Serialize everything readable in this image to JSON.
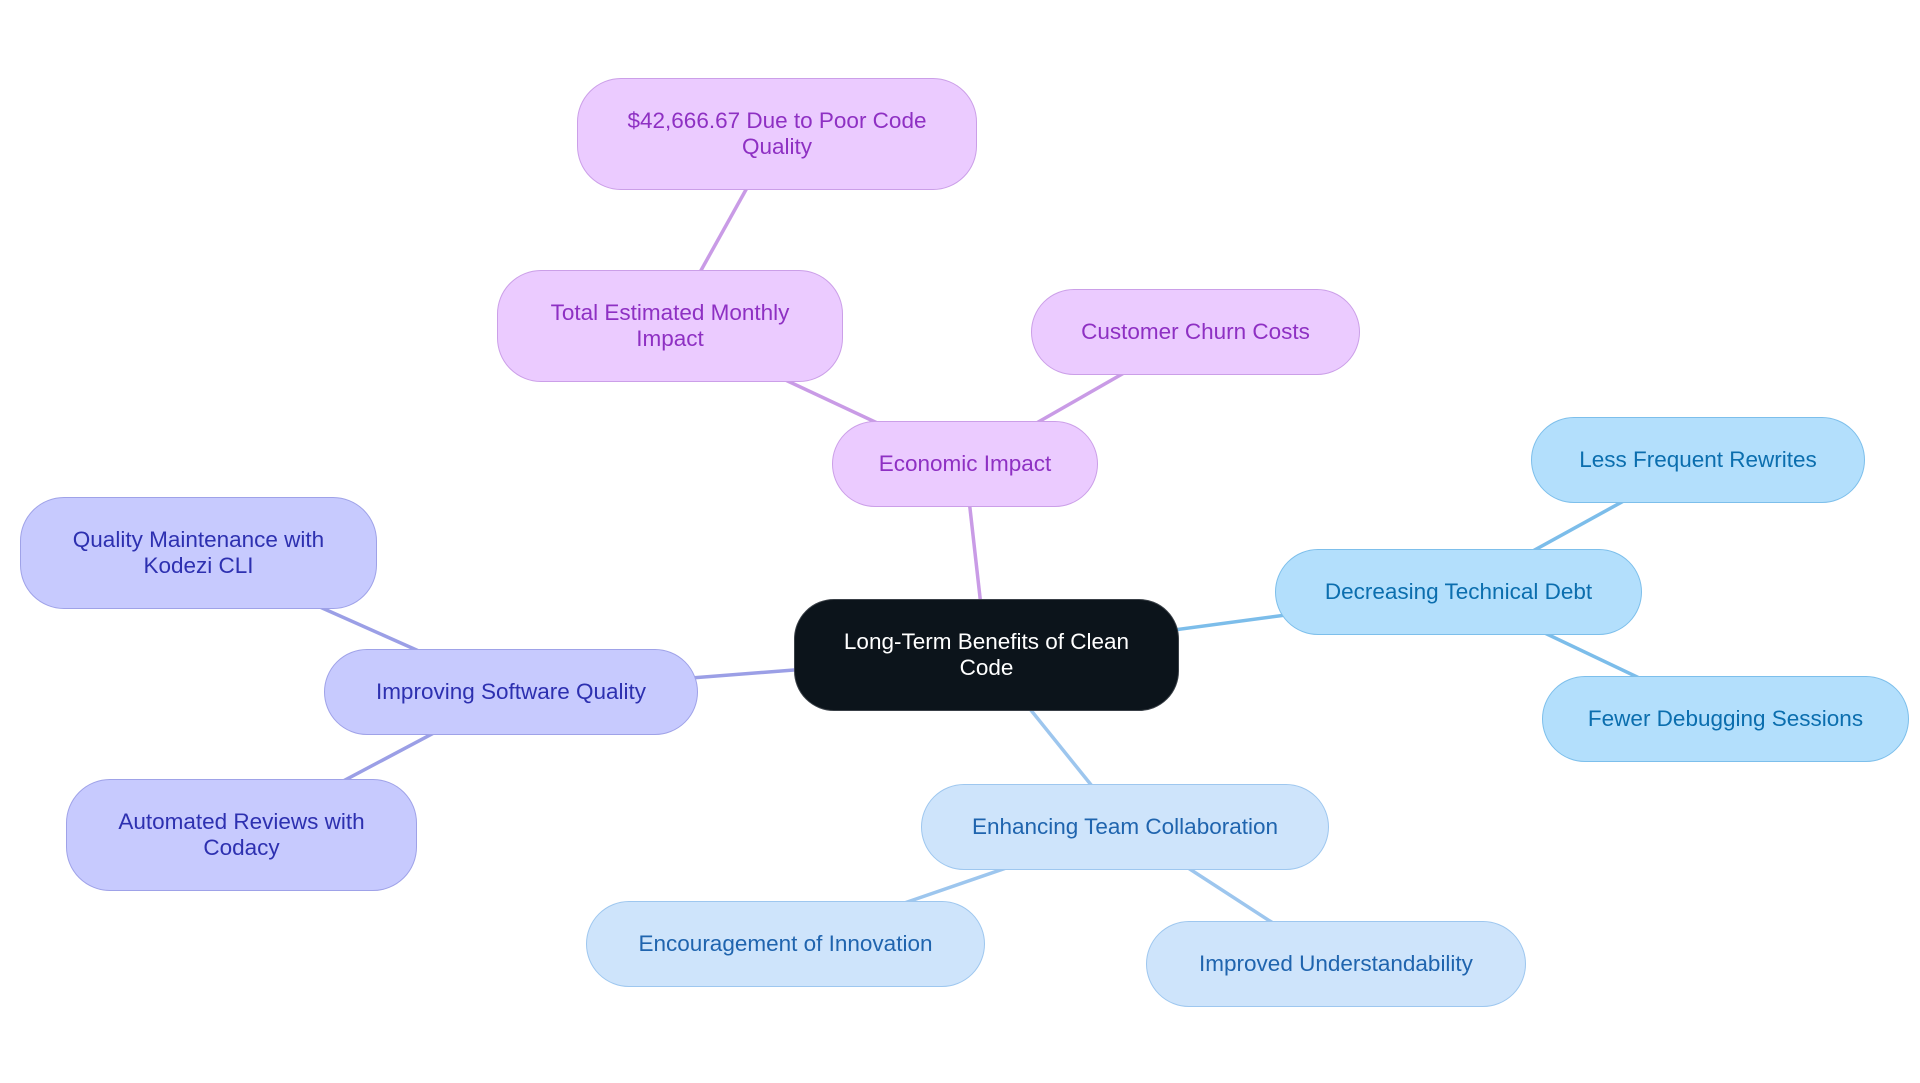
{
  "title": "Long-Term Benefits of Clean Code",
  "colors": {
    "root_fill": "#0C141B",
    "economic_fill": "#EBCBFF",
    "economic_text": "#8E30C3",
    "economic_edge": "#C99BE6",
    "quality_fill": "#C7CAFE",
    "quality_text": "#2D30B0",
    "quality_edge": "#9B9FE6",
    "debt_fill": "#B3DFFC",
    "debt_text": "#0B6EAE",
    "debt_edge": "#7CBDEA",
    "collab_fill": "#CEE4FB",
    "collab_text": "#1F64AE",
    "collab_edge": "#9DC6EE"
  },
  "nodes": {
    "root": {
      "label": "Long-Term Benefits of Clean Code"
    },
    "economic": {
      "label": "Economic Impact"
    },
    "monthly": {
      "label": "Total Estimated Monthly Impact"
    },
    "poor_quality": {
      "label": "$42,666.67 Due to Poor Code Quality"
    },
    "churn": {
      "label": "Customer Churn Costs"
    },
    "debt": {
      "label": "Decreasing Technical Debt"
    },
    "rewrites": {
      "label": "Less Frequent Rewrites"
    },
    "debugging": {
      "label": "Fewer Debugging Sessions"
    },
    "collab": {
      "label": "Enhancing Team Collaboration"
    },
    "innovation": {
      "label": "Encouragement of Innovation"
    },
    "understand": {
      "label": "Improved Understandability"
    },
    "quality": {
      "label": "Improving Software Quality"
    },
    "kodezi": {
      "label": "Quality Maintenance with Kodezi CLI"
    },
    "codacy": {
      "label": "Automated Reviews with Codacy"
    }
  },
  "edges": [
    {
      "from": "root",
      "to": "economic",
      "color": "#C99BE6"
    },
    {
      "from": "economic",
      "to": "monthly",
      "color": "#C99BE6"
    },
    {
      "from": "monthly",
      "to": "poor_quality",
      "color": "#C99BE6"
    },
    {
      "from": "economic",
      "to": "churn",
      "color": "#C99BE6"
    },
    {
      "from": "root",
      "to": "debt",
      "color": "#7CBDEA"
    },
    {
      "from": "debt",
      "to": "rewrites",
      "color": "#7CBDEA"
    },
    {
      "from": "debt",
      "to": "debugging",
      "color": "#7CBDEA"
    },
    {
      "from": "root",
      "to": "collab",
      "color": "#9DC6EE"
    },
    {
      "from": "collab",
      "to": "innovation",
      "color": "#9DC6EE"
    },
    {
      "from": "collab",
      "to": "understand",
      "color": "#9DC6EE"
    },
    {
      "from": "root",
      "to": "quality",
      "color": "#9B9FE6"
    },
    {
      "from": "quality",
      "to": "kodezi",
      "color": "#9B9FE6"
    },
    {
      "from": "quality",
      "to": "codacy",
      "color": "#9B9FE6"
    }
  ]
}
